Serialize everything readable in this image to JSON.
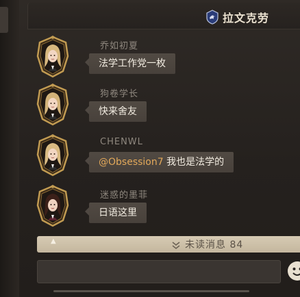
{
  "header": {
    "channel_name": "拉文克劳",
    "house_icon": "raven-crest-icon"
  },
  "messages": [
    {
      "sender": "乔如初夏",
      "text": "法学工作党一枚",
      "avatar": "blonde-girl-avatar"
    },
    {
      "sender": "狗卷学长",
      "text": "快来舍友",
      "avatar": "blonde-girl-avatar"
    },
    {
      "sender": "CHENWL",
      "mention": "@Obsession7",
      "text": " 我也是法学的",
      "avatar": "blonde-girl-avatar"
    },
    {
      "sender": "迷惑的墨菲",
      "text": "日语这里",
      "avatar": "dark-hair-girl-avatar"
    }
  ],
  "unread": {
    "label": "未读消息 84"
  },
  "input": {
    "placeholder": ""
  },
  "colors": {
    "mention": "#e2a85a",
    "bubble": "#4d463f",
    "frame_gold": "#c19b52",
    "unread_bar": "#cfc2a9"
  }
}
